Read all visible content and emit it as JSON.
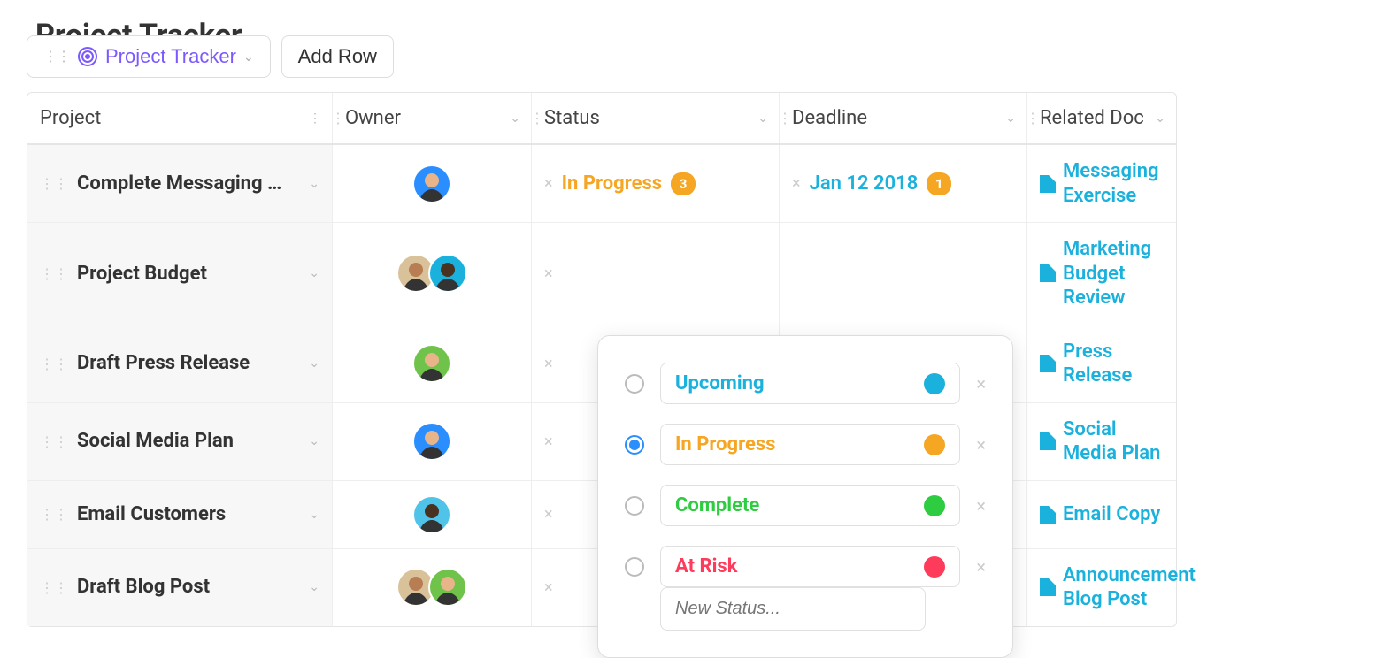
{
  "page": {
    "title": "Project Tracker"
  },
  "toolbar": {
    "tracker_label": "Project Tracker",
    "add_row_label": "Add Row"
  },
  "columns": {
    "project": "Project",
    "owner": "Owner",
    "status": "Status",
    "deadline": "Deadline",
    "related_doc": "Related Doc"
  },
  "colors": {
    "link": "#1ab1dd",
    "upcoming": "#1ab1dd",
    "in_progress": "#f5a623",
    "complete": "#2ecc40",
    "at_risk": "#ff3b5c",
    "badge": "#f5a623"
  },
  "rows": [
    {
      "project": "Complete Messaging …",
      "owners": [
        {
          "bg": "#2b8eff",
          "skin": "#e8b48a"
        }
      ],
      "status": {
        "label": "In Progress",
        "color": "#f5a623",
        "badge": "3"
      },
      "deadline": {
        "label": "Jan 12 2018",
        "badge": "1"
      },
      "doc": "Messaging Exercise"
    },
    {
      "project": "Project Budget",
      "owners": [
        {
          "bg": "#d9c29a",
          "skin": "#b87d52"
        },
        {
          "bg": "#1ab1dd",
          "skin": "#4a3220"
        }
      ],
      "status": null,
      "deadline": null,
      "doc": "Marketing Budget Review"
    },
    {
      "project": "Draft Press Release",
      "owners": [
        {
          "bg": "#6fc24a",
          "skin": "#e8b48a"
        }
      ],
      "status": null,
      "deadline": null,
      "doc": "Press Release"
    },
    {
      "project": "Social Media Plan",
      "owners": [
        {
          "bg": "#2b8eff",
          "skin": "#e8b48a"
        }
      ],
      "status": null,
      "deadline": null,
      "doc": "Social Media Plan"
    },
    {
      "project": "Email Customers",
      "owners": [
        {
          "bg": "#4fc3e8",
          "skin": "#4a3220"
        }
      ],
      "status": null,
      "deadline": null,
      "doc": "Email Copy"
    },
    {
      "project": "Draft Blog Post",
      "owners": [
        {
          "bg": "#d9c29a",
          "skin": "#b87d52"
        },
        {
          "bg": "#6fc24a",
          "skin": "#e8b48a"
        }
      ],
      "status": null,
      "deadline": null,
      "doc": "Announcement Blog Post"
    }
  ],
  "status_popup": {
    "options": [
      {
        "label": "Upcoming",
        "color": "#1ab1dd",
        "selected": false
      },
      {
        "label": "In Progress",
        "color": "#f5a623",
        "selected": true
      },
      {
        "label": "Complete",
        "color": "#2ecc40",
        "selected": false
      },
      {
        "label": "At Risk",
        "color": "#ff3b5c",
        "selected": false
      }
    ],
    "new_placeholder": "New Status..."
  }
}
